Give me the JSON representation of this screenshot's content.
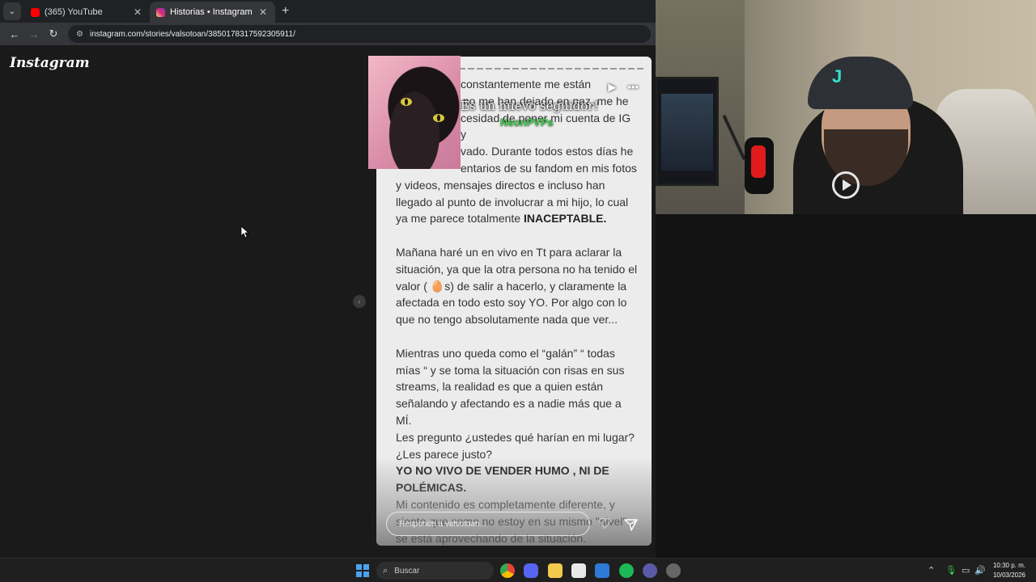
{
  "browser": {
    "tabs": [
      {
        "title": "(365) YouTube",
        "favicon": "youtube-icon",
        "active": false
      },
      {
        "title": "Historias • Instagram",
        "favicon": "instagram-icon",
        "active": true
      }
    ],
    "url": "instagram.com/stories/valsotoan/3850178317592305911/"
  },
  "instagram": {
    "logo": "Instagram",
    "story": {
      "lines": [
        {
          "text": "constantemente me están",
          "bold": false
        },
        {
          "text": "y no me han dejado en paz, me he",
          "bold": false
        },
        {
          "text": "cesidad de poner mi cuenta de IG y",
          "bold": false
        },
        {
          "text": "vado. Durante todos estos días he",
          "bold": false
        },
        {
          "text": "entarios de su fandom en mis fotos",
          "bold": false
        },
        {
          "text": "y videos, mensajes directos e incluso han",
          "bold": false
        },
        {
          "text": "llegado al punto de involucrar a mi hijo, lo cual",
          "bold": false
        },
        {
          "text": "ya me parece totalmente",
          "bold": false,
          "suffix_bold": "INACEPTABLE."
        },
        {
          "text": "",
          "bold": false
        },
        {
          "text": "Mañana haré un en vivo en Tt para aclarar la",
          "bold": false
        },
        {
          "text": "situación, ya que la otra persona no ha tenido el",
          "bold": false
        },
        {
          "text": "valor ( 🥚s) de salir a hacerlo, y claramente la",
          "bold": false
        },
        {
          "text": "afectada en todo esto soy YO. Por algo con lo",
          "bold": false
        },
        {
          "text": "que no tengo absolutamente nada que ver...",
          "bold": false
        },
        {
          "text": "",
          "bold": false
        },
        {
          "text": "Mientras uno queda como el “galán”  “ todas",
          "bold": false
        },
        {
          "text": "mías “ y se toma la situación con risas en sus",
          "bold": false
        },
        {
          "text": "streams, la realidad es que a quien están",
          "bold": false
        },
        {
          "text": "señalando y afectando es a nadie más que a MÍ.",
          "bold": false
        },
        {
          "text": "Les pregunto ¿ustedes qué harían en mi lugar?",
          "bold": false
        },
        {
          "text": "¿Les parece justo?",
          "bold": false
        },
        {
          "text": "YO NO VIVO DE VENDER HUMO , NI DE",
          "bold": true
        },
        {
          "text": "POLÉMICAS.",
          "bold": true
        },
        {
          "text": "Mi contenido es completamente diferente, y",
          "bold": false
        },
        {
          "text": "siento que como no estoy en su mismo \"nivel\" ,",
          "bold": false
        },
        {
          "text": "se está aprovechando de la situación.",
          "bold": false
        }
      ],
      "reply_placeholder": "Responde a valsotoan...",
      "controls": {
        "play": "▶",
        "more": "•••"
      }
    }
  },
  "overlay": {
    "title": "Es un nuevo seguidor!",
    "name": "NeonPVPs"
  },
  "taskbar": {
    "search_label": "Buscar",
    "time": "10:30 p. m.",
    "date": "10/03/2026",
    "colors": {
      "chrome": "#fbbc04",
      "discord": "#5865f2",
      "spotify": "#1db954",
      "folder": "#f2c94c"
    }
  }
}
